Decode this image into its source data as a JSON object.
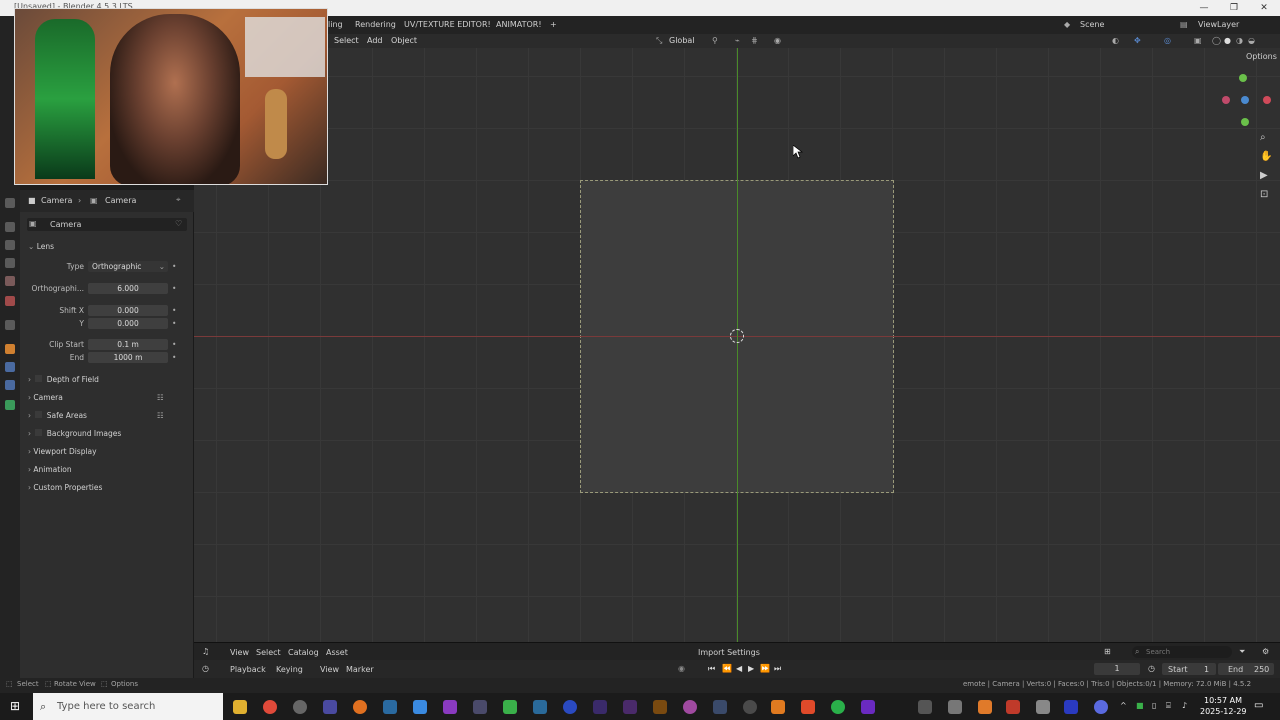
{
  "titlebar": {
    "title": "[Unsaved] - Blender 4.5.3 LTS"
  },
  "workspace_tabs": [
    "ling",
    "Rendering",
    "UV/TEXTURE EDITOR!",
    "ANIMATOR!",
    "+"
  ],
  "scene": {
    "label": "Scene",
    "view_layer": "ViewLayer"
  },
  "header3d": {
    "menus": [
      "Select",
      "Add",
      "Object"
    ],
    "orientation": "Global",
    "options": "Options"
  },
  "properties": {
    "breadcrumb": [
      "Camera",
      "Camera"
    ],
    "data_name": "Camera",
    "section": "Lens",
    "type_label": "Type",
    "type_value": "Orthographic",
    "ortho_label": "Orthographi...",
    "ortho_value": "6.000",
    "shift_x_label": "Shift X",
    "shift_x_value": "0.000",
    "shift_y_label": "Y",
    "shift_y_value": "0.000",
    "clip_start_label": "Clip Start",
    "clip_start_value": "0.1 m",
    "clip_end_label": "End",
    "clip_end_value": "1000 m",
    "panels": [
      "Depth of Field",
      "Camera",
      "Safe Areas",
      "Background Images",
      "Viewport Display",
      "Animation",
      "Custom Properties"
    ]
  },
  "asset_header": {
    "menus": [
      "View",
      "Select",
      "Catalog",
      "Asset"
    ],
    "import": "Import Settings",
    "search_placeholder": "Search"
  },
  "timeline": {
    "menus": [
      "Playback",
      "Keying",
      "View",
      "Marker"
    ],
    "frame": "1",
    "start_label": "Start",
    "start": "1",
    "end_label": "End",
    "end": "250"
  },
  "statusbar": {
    "left": [
      "Select",
      "Rotate View",
      "Options"
    ],
    "right": "emote | Camera | Verts:0 | Faces:0 | Tris:0 | Objects:0/1 | Memory: 72.0 MiB | 4.5.2"
  },
  "taskbar": {
    "search_placeholder": "Type here to search",
    "time": "10:57 AM",
    "date": "2025-12-29"
  },
  "colors": {
    "accent": "#4a8a2a",
    "x_axis": "#b33a3a",
    "y_axis": "#4a8a2a"
  }
}
